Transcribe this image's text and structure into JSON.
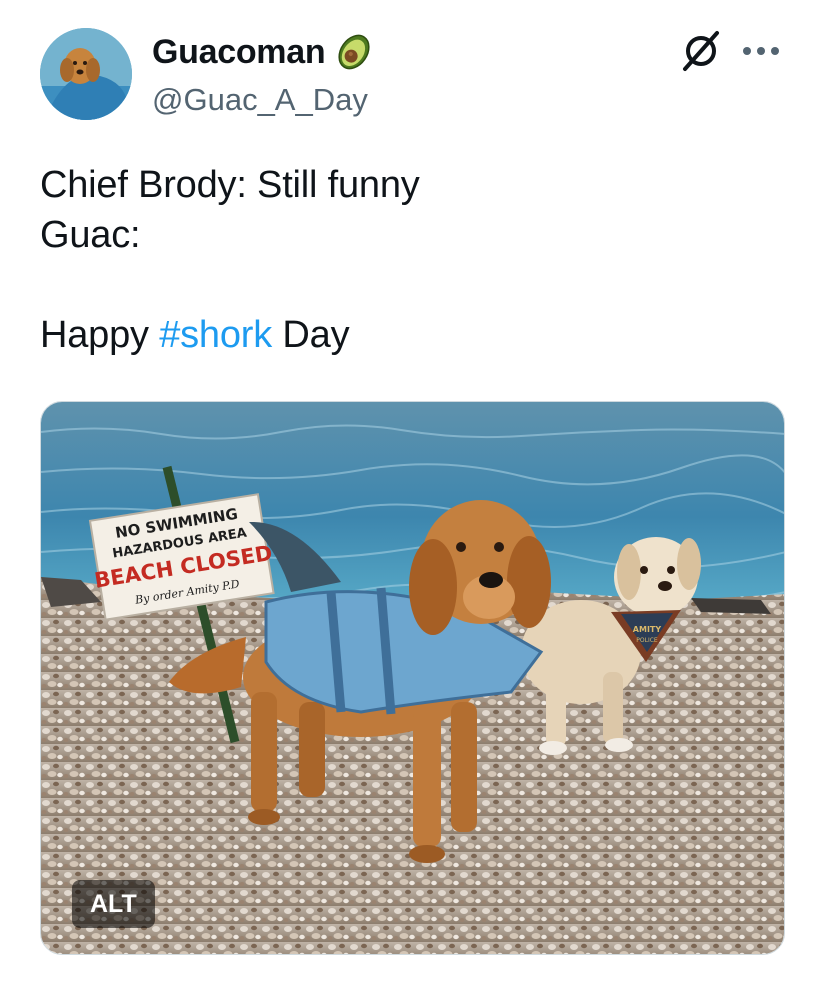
{
  "author": {
    "display_name": "Guacoman",
    "handle": "@Guac_A_Day",
    "avatar_icon": "avatar-dog-photo",
    "badge_icon": "avocado-icon"
  },
  "header_actions": {
    "grok_icon": "grok-icon",
    "more_icon": "more-horizontal-icon"
  },
  "tweet": {
    "line1": "Chief Brody:  Still funny",
    "line2": "Guac:",
    "line3_prefix": "Happy ",
    "hashtag": "#shork",
    "line3_suffix": " Day"
  },
  "media": {
    "sign_line1": "NO SWIMMING",
    "sign_line2": "HAZARDOUS AREA",
    "sign_line3": "BEACH CLOSED",
    "sign_line4": "By order Amity  P.D",
    "bandana_line1": "AMITY",
    "bandana_line2": "POLICE",
    "alt_label": "ALT"
  },
  "colors": {
    "hashtag": "#1d9bf0",
    "handle": "#536471",
    "text": "#0f1419"
  }
}
